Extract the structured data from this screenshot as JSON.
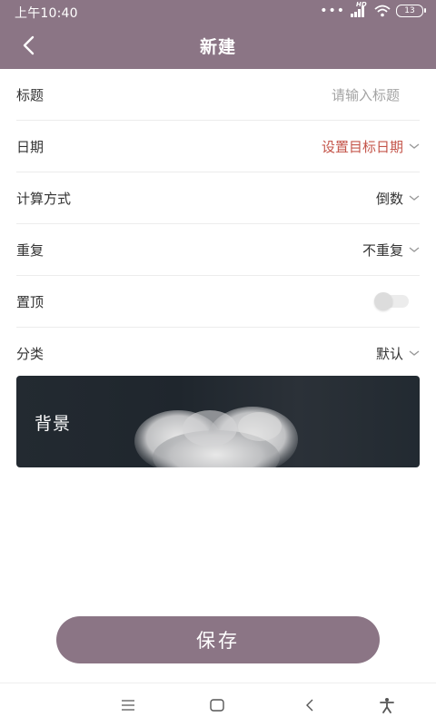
{
  "status_bar": {
    "time": "上午10:40",
    "network": "HD",
    "battery": "13"
  },
  "header": {
    "title": "新建",
    "back_icon": "chevron-left-icon"
  },
  "form": {
    "title_row": {
      "label": "标题",
      "placeholder": "请输入标题"
    },
    "date_row": {
      "label": "日期",
      "value": "设置目标日期"
    },
    "calc_row": {
      "label": "计算方式",
      "value": "倒数"
    },
    "repeat_row": {
      "label": "重复",
      "value": "不重复"
    },
    "pin_row": {
      "label": "置顶",
      "enabled": false
    },
    "category_row": {
      "label": "分类",
      "value": "默认"
    }
  },
  "background": {
    "label": "背景"
  },
  "save_button": {
    "label": "保存"
  },
  "colors": {
    "brand": "#8b7585",
    "accent": "#c4554a"
  },
  "nav_bar": {
    "icons": [
      "menu-icon",
      "home-icon",
      "back-icon",
      "accessibility-icon"
    ]
  }
}
